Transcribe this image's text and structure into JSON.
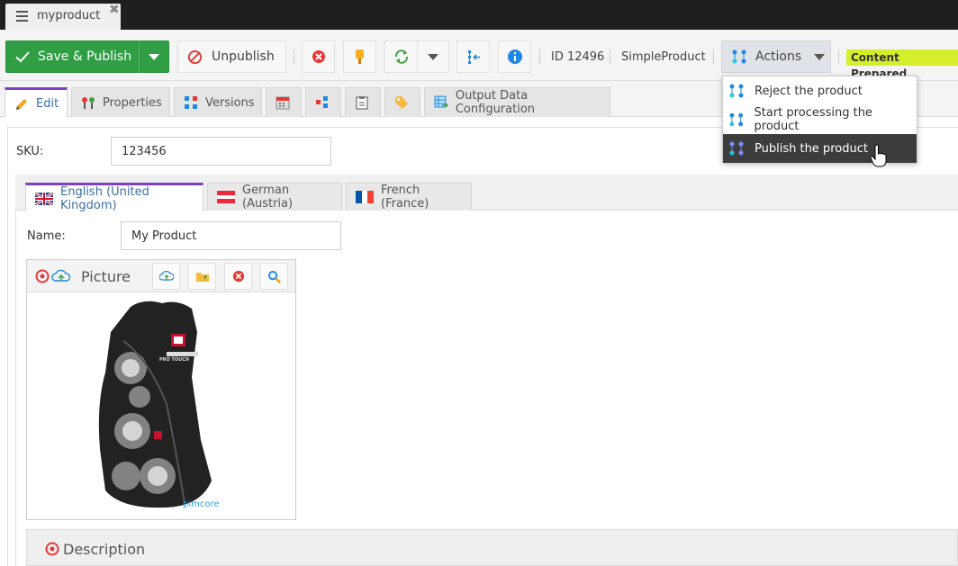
{
  "document_tab": {
    "title": "myproduct",
    "close": "✖"
  },
  "toolbar": {
    "save_publish": "Save & Publish",
    "unpublish": "Unpublish",
    "id_text": "ID 12496",
    "class_name": "SimpleProduct",
    "actions": "Actions",
    "status": "Content Prepared"
  },
  "editor_tabs": [
    {
      "label": "Edit"
    },
    {
      "label": "Properties"
    },
    {
      "label": "Versions"
    },
    {
      "label": ""
    },
    {
      "label": ""
    },
    {
      "label": ""
    },
    {
      "label": ""
    },
    {
      "label": "Output Data Configuration"
    }
  ],
  "sku": {
    "label": "SKU:",
    "value": "123456"
  },
  "language_tabs": [
    {
      "label": "English (United Kingdom)"
    },
    {
      "label": "German (Austria)"
    },
    {
      "label": "French (France)"
    }
  ],
  "name": {
    "label": "Name:",
    "value": "My Product"
  },
  "picture": {
    "title": "Picture",
    "brand_text": "PRO TOUCH",
    "watermark": "pimcore"
  },
  "description": {
    "title": "Description"
  },
  "actions_menu": {
    "items": [
      {
        "label": "Reject the product"
      },
      {
        "label": "Start processing the product"
      },
      {
        "label": "Publish the product"
      }
    ]
  },
  "colors": {
    "publish_green": "#2f9e44",
    "active_tab_border": "#7e3fbf",
    "status_badge": "#d4ee2c",
    "menu_hover": "#3d3d3d"
  }
}
